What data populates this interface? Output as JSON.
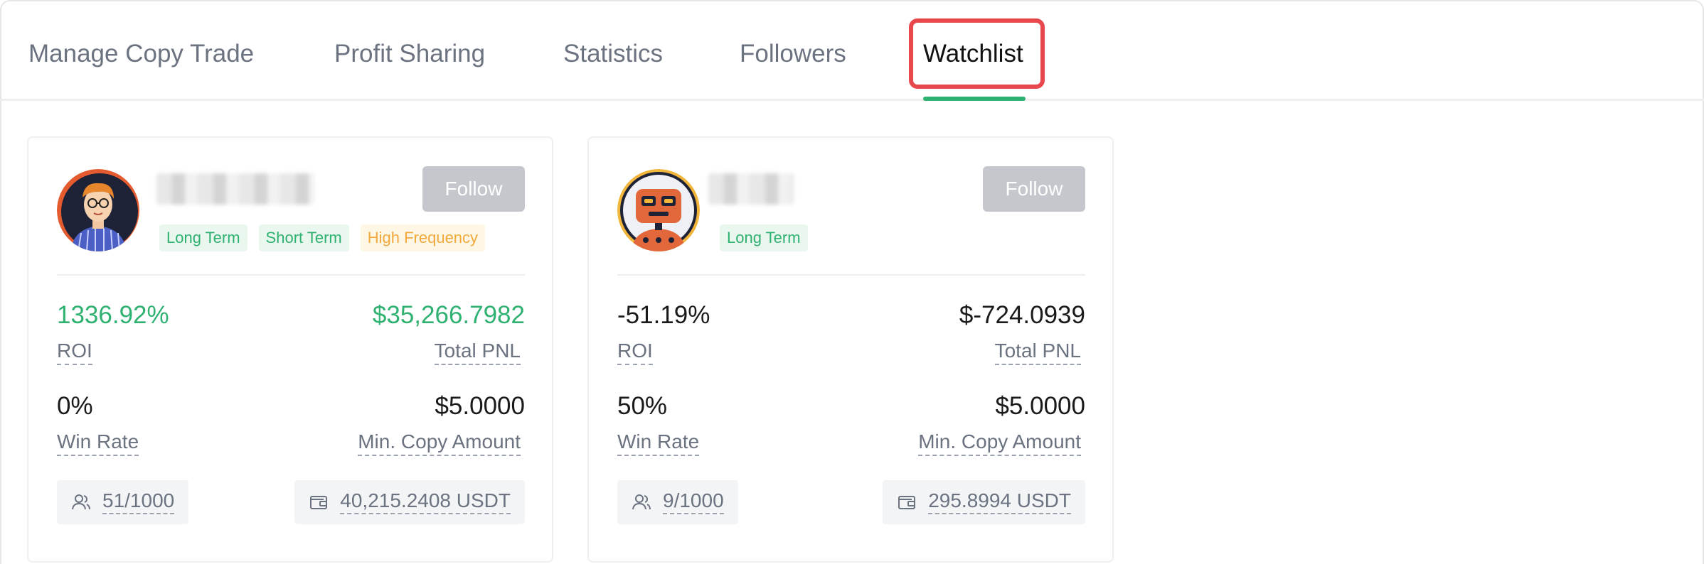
{
  "tabs": [
    {
      "label": "Manage Copy Trade"
    },
    {
      "label": "Profit Sharing"
    },
    {
      "label": "Statistics"
    },
    {
      "label": "Followers"
    },
    {
      "label": "Watchlist",
      "active": true
    }
  ],
  "colors": {
    "accent_green": "#2fb171",
    "highlight_red": "#e8474b",
    "tag_yellow": "#f2a93b",
    "follow_button": "#c4c7cc"
  },
  "cards": [
    {
      "avatar_icon": "man-with-glasses-avatar-icon",
      "tags": [
        {
          "label": "Long Term"
        },
        {
          "label": "Short Term"
        },
        {
          "label": "High Frequency"
        }
      ],
      "follow_label": "Follow",
      "roi": "1336.92%",
      "roi_label": "ROI",
      "total_pnl": "$35,266.7982",
      "total_pnl_label": "Total PNL",
      "win_rate": "0%",
      "win_rate_label": "Win Rate",
      "min_copy_amount": "$5.0000",
      "min_copy_amount_label": "Min. Copy Amount",
      "followers": "51/1000",
      "followers_icon": "users-icon",
      "aum": "40,215.2408 USDT",
      "aum_icon": "wallet-icon"
    },
    {
      "avatar_icon": "robot-avatar-icon",
      "tags": [
        {
          "label": "Long Term"
        }
      ],
      "follow_label": "Follow",
      "roi": "-51.19%",
      "roi_label": "ROI",
      "total_pnl": "$-724.0939",
      "total_pnl_label": "Total PNL",
      "win_rate": "50%",
      "win_rate_label": "Win Rate",
      "min_copy_amount": "$5.0000",
      "min_copy_amount_label": "Min. Copy Amount",
      "followers": "9/1000",
      "followers_icon": "users-icon",
      "aum": "295.8994 USDT",
      "aum_icon": "wallet-icon"
    }
  ]
}
